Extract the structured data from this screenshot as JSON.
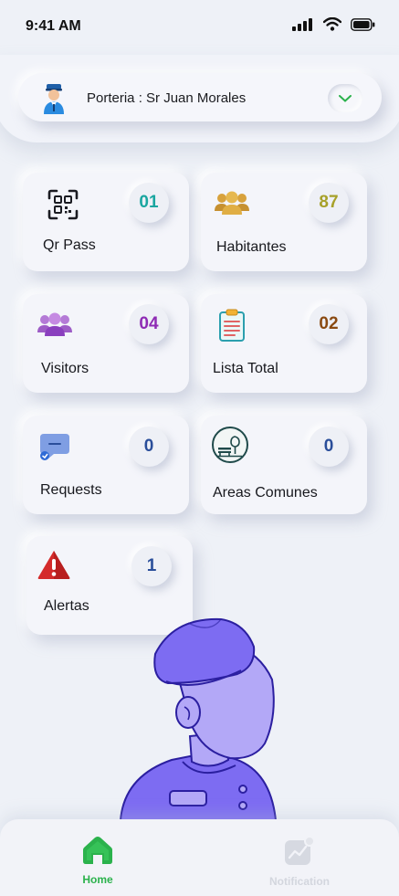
{
  "status_bar": {
    "time": "9:41 AM"
  },
  "header": {
    "profile_label": "Porteria : Sr Juan Morales"
  },
  "cards": {
    "qr_pass": {
      "label": "Qr Pass",
      "count": "01",
      "count_color": "#1aa6a0"
    },
    "habitantes": {
      "label": "Habitantes",
      "count": "87",
      "count_color": "#a7a12a"
    },
    "visitors": {
      "label": "Visitors",
      "count": "04",
      "count_color": "#8e2bb4"
    },
    "lista_total": {
      "label": "Lista Total",
      "count": "02",
      "count_color": "#8a4a12"
    },
    "requests": {
      "label": "Requests",
      "count": "0",
      "count_color": "#2a4e9a"
    },
    "areas_comunes": {
      "label": "Areas Comunes",
      "count": "0",
      "count_color": "#2a4e9a"
    },
    "alertas": {
      "label": "Alertas",
      "count": "1",
      "count_color": "#2a4e9a"
    }
  },
  "nav": {
    "home": {
      "label": "Home",
      "color": "#2bb24c",
      "active": true
    },
    "notification": {
      "label": "Notification",
      "color": "#d3d6de",
      "active": false
    }
  },
  "icons": {
    "qr": "qr-code-icon",
    "people": "people-group-icon",
    "clipboard": "clipboard-icon",
    "chat": "chat-bubble-icon",
    "park": "park-bench-icon",
    "warning": "warning-triangle-icon"
  }
}
